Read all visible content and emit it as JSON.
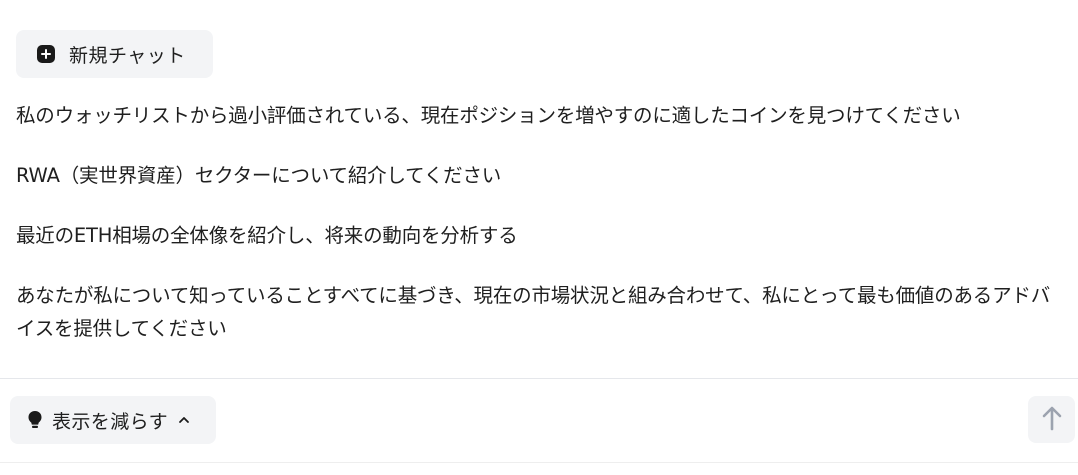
{
  "new_chat": {
    "label": "新規チャット"
  },
  "suggestions": [
    "私のウォッチリストから過小評価されている、現在ポジションを増やすのに適したコインを見つけてください",
    "RWA（実世界資産）セクターについて紹介してください",
    "最近のETH相場の全体像を紹介し、将来の動向を分析する",
    "あなたが私について知っていることすべてに基づき、現在の市場状況と組み合わせて、私にとって最も価値のあるアドバイスを提供してください"
  ],
  "footer": {
    "show_less_label": "表示を減らす"
  },
  "icons": {
    "new_chat": "plus-square-icon",
    "show_less": "lightbulb-icon",
    "toggle": "chevron-up-icon",
    "send": "arrow-up-icon"
  },
  "colors": {
    "button_bg": "#f3f4f6",
    "text": "#1f1f1f",
    "send_arrow": "#9ca3af",
    "divider": "#e5e7eb"
  }
}
